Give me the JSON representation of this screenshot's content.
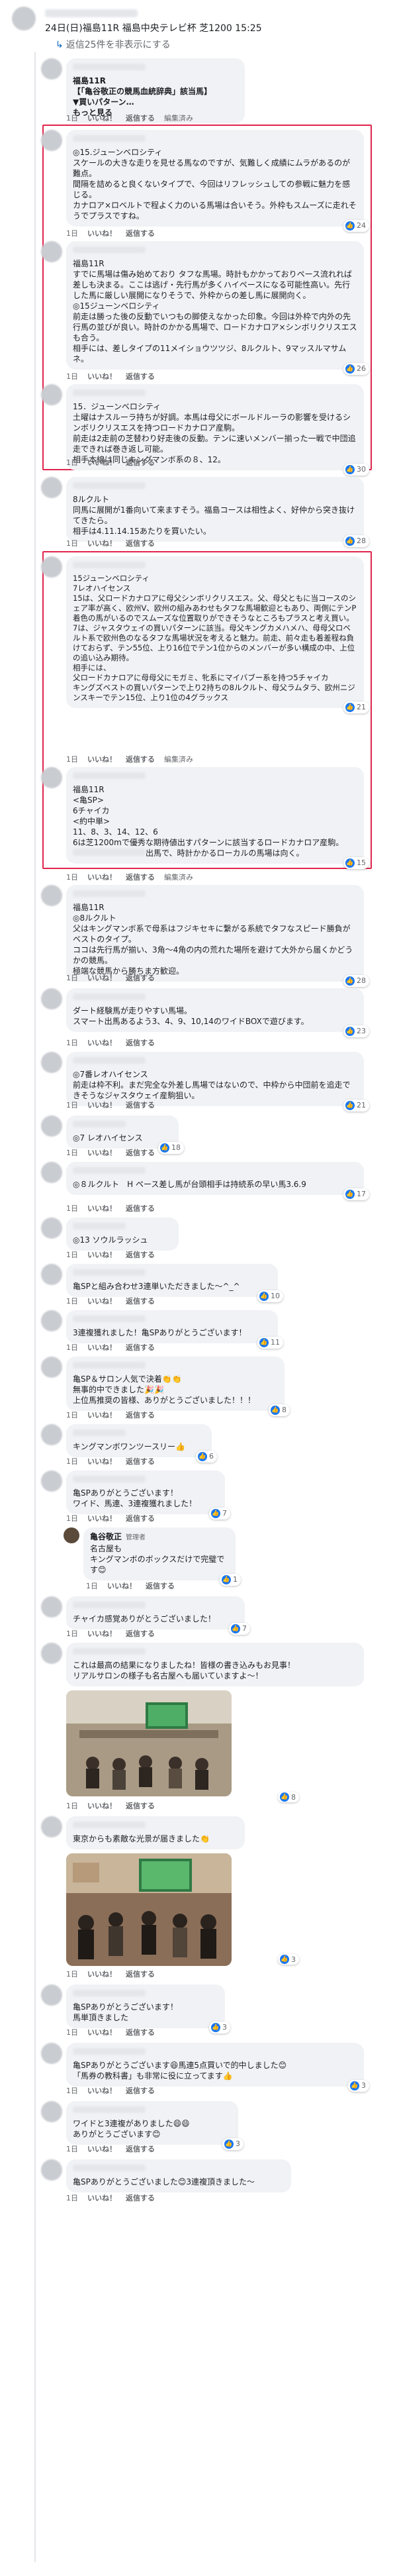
{
  "post": {
    "title": "24日(日)福島11R 福島中央テレビ杯 芝1200 15:25"
  },
  "hide_replies": "返信25件を非表示にする",
  "actions": {
    "like": "いいね！",
    "reply": "返信する",
    "edit": "編集済み"
  },
  "comments": [
    {
      "text": "福島11R\n【「亀谷敬正の競馬血統辞典」該当馬】\n▼買いパターン…",
      "more": "もっと見る",
      "time": "1日",
      "reacts": ""
    },
    {
      "text": "◎15.ジューンベロシティ\nスケールの大きな走りを見せる馬なのですが、気難しく成績にムラがあるのが難点。\n間隔を詰めると良くないタイプで、今回はリフレッシュしての参戦に魅力を感じる。\nカナロア×ロベルトで程よく力のいる馬場は合いそう。外枠もスムーズに走れそうでプラスですね。",
      "time": "1日",
      "reacts": "24"
    },
    {
      "text": "福島11R\nすでに馬場は傷み始めており タフな馬場。時計もかかっておりペース流れれば差しも決まる。ここは逃げ・先行馬が多くハイペースになる可能性高い。先行した馬に厳しい展開になりそうで、外枠からの差し馬に展開向く。\n◎15ジューンベロシティ\n前走は勝った後の反動でいつもの脚使えなかった印象。今回は外枠で内外の先行馬の並びが良い。時計のかかる馬場で、ロードカナロア×シンボリクリスエスも合う。\n相手には、差しタイプの11メイショウツツジ、8ルクルト、9マッスルマサムネ。",
      "time": "1日",
      "reacts": "26"
    },
    {
      "text": "15．ジューンベロシティ\n土曜はナスルーラ持ちが好調。本馬は母父にボールドルーラの影響を受けるシンボリクリスエスを持つロードカナロア産駒。\n前走は2走前の芝替わり好走後の反動。テンに速いメンバー揃った一戦で中団追走できれば巻き返し可能。\n相手本線は同じキングマンボ系の８、12。",
      "time": "1日",
      "reacts": "30"
    },
    {
      "text": "8ルクルト\n同馬に展開が1番向いて来ますそう。福島コースは相性よく、好仲から突き抜けてきたら。\n相手は4.11.14.15あたりを買いたい。",
      "time": "1日",
      "reacts": "28"
    },
    {
      "text": "15ジューンベロシティ\n7レオハイセンス\n15は、父ロードカナロアに母父シンボリクリスエス。父、母父ともに当コースのシェア率が高く、欧州V、欧州の組みあわせもタフな馬場歓迎ともあり、両側にテンP着色の馬がいるのでスムーズな位置取りができそうなところもプラスと考え買い。\n7は、ジャスタウェイの買いパターンに該当。母父キングカメハメハ、母母父ロベルト系で欧州色のなるタフな馬場状況を考えると魅力。前走、前々走も着差程ね負けておらず、テン55位、上り16位でテン1位からのメンバーが多い構成の中、上位の追い込み期待。\n相手には、\n父ロードカナロアに母母父にモガミ、牝系にマイバブー系を持つ5チャイカ\nキングズベストの買いパターンで上り2持ちの8ルクルト、母父ラムタラ、欧州ニジンスキーでテン15位、上り1位の4グラックス",
      "time": "1日",
      "reacts": "21"
    },
    {
      "text": "福島11R\n<亀SP>\n6チャイカ\n<約中単>\n11、8、3、14、12、6\n6は芝1200mで優秀な期待値出すパターンに該当するロードカナロア産駒。",
      "tail": "出馬で、時計かかるローカルの馬場は向く。",
      "time": "1日",
      "reacts": "15"
    },
    {
      "text": "福島11R\n◎8ルクルト\n父はキングマンボ系で母系はフジキセキに繋がる系統でタフなスピード勝負がベストのタイプ。\nココは先行馬が揃い、3角〜4角の内の荒れた場所を避けて大外から届くかどうかの競馬。\n極端な競馬から勝ちま方歓迎。",
      "time": "1日",
      "reacts": "28"
    },
    {
      "text": "ダート経験馬が走りやすい馬場。\nスマート出馬あるよう3、4、9、10,14のワイドBOXで遊びます。",
      "time": "1日",
      "reacts": "23"
    },
    {
      "text": "◎7番レオハイセンス\n前走は枠不利。まだ完全な外差し馬場ではないので、中枠から中団前を追走できそうなジャスタウェイ産駒狙い。",
      "time": "1日",
      "reacts": "21"
    },
    {
      "text": "◎7 レオハイセンス",
      "time": "1日",
      "reacts": "18"
    },
    {
      "text": "◎８ルクルト　H ペース差し馬が台頭相手は持続系の早い馬3.6.9",
      "time": "1日",
      "reacts": "17"
    },
    {
      "text": "◎13 ソウルラッシュ",
      "time": "1日",
      "reacts": ""
    },
    {
      "text": "亀SPと組み合わせ3連単いただきました〜^_^",
      "time": "1日",
      "reacts": "10"
    },
    {
      "text": "3連複獲れました！亀SPありがとうございます！",
      "time": "1日",
      "reacts": "11"
    },
    {
      "text": "亀SP＆サロン人気で決着👏👏\n無事的中できました🎉🎉\n上位馬推奨の皆様、ありがとうございました！！！",
      "time": "1日",
      "reacts": "8"
    },
    {
      "text": "キングマンボワンツースリー👍",
      "time": "1日",
      "reacts": "6"
    },
    {
      "text": "亀SPありがとうございます！\nワイド、馬連、3連複獲れました！",
      "time": "1日",
      "reacts": "7"
    },
    {
      "author": "亀谷敬正",
      "badge": "管理者",
      "text": "名古屋も\nキングマンボのボックスだけで完璧です😊",
      "time": "1日",
      "reacts": "1"
    },
    {
      "text": "チャイカ感覚ありがとうございました！",
      "time": "1日",
      "reacts": "7"
    },
    {
      "text": "これは最高の結果になりましたね！皆様の書き込みもお見事！\nリアルサロンの様子も名古屋へも届いていますよ〜！",
      "time": "1日",
      "reacts": "8"
    },
    {
      "text": "東京からも素敵な光景が届きました👏",
      "time": "1日",
      "reacts": "3"
    },
    {
      "text": "亀SPありがとうございます！\n馬単頂きました",
      "time": "1日",
      "reacts": "3"
    },
    {
      "text": "亀SPありがとうございます😆馬連5点買いで的中しました😊\n「馬券の教科書」も非常に役に立ってます👍",
      "time": "1日",
      "reacts": "3"
    },
    {
      "text": "ワイドと3連複がありました😄😄\nありがとうございます😊",
      "time": "1日",
      "reacts": "3"
    },
    {
      "text": "亀SPありがとうございました😊3連複頂きました〜",
      "time": "1日",
      "reacts": ""
    }
  ],
  "colors": {
    "highlight": "#e0254c",
    "bubble": "#f0f2f5",
    "like": "#1877f2",
    "link": "#0a66c2"
  }
}
